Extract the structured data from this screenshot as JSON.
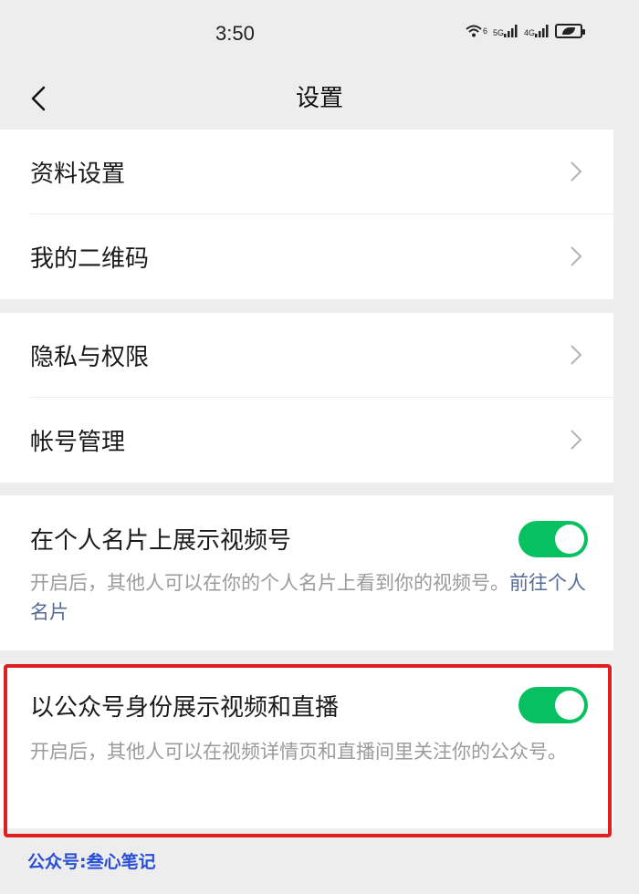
{
  "status_bar": {
    "time": "3:50",
    "wifi_label": "6",
    "signal1_label": "5G",
    "signal2_label": "4G"
  },
  "header": {
    "title": "设置",
    "back_icon": "chevron-left-icon"
  },
  "groups": [
    {
      "items": [
        {
          "label": "资料设置"
        },
        {
          "label": "我的二维码"
        }
      ]
    },
    {
      "items": [
        {
          "label": "隐私与权限"
        },
        {
          "label": "帐号管理"
        }
      ]
    }
  ],
  "toggles": [
    {
      "label": "在个人名片上展示视频号",
      "enabled": true,
      "description": "开启后，其他人可以在你的个人名片上看到你的视频号。",
      "link": "前往个人名片"
    },
    {
      "label": "以公众号身份展示视频和直播",
      "enabled": true,
      "description": "开启后，其他人可以在视频详情页和直播间里关注你的公众号。"
    }
  ],
  "watermark": "公众号:叁心笔记",
  "colors": {
    "background": "#ededed",
    "toggle_on": "#07c160",
    "link": "#576b95",
    "highlight": "#e02020",
    "watermark": "#2a4fd7"
  }
}
